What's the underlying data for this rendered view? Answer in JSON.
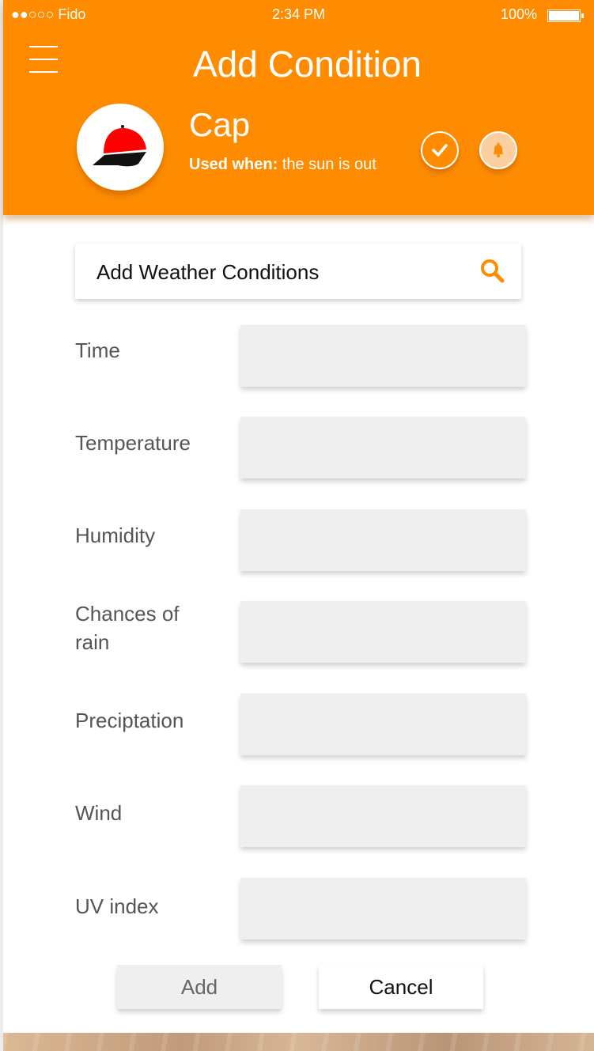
{
  "status_bar": {
    "carrier": "●●○○○ Fido",
    "time": "2:34 PM",
    "battery": "100%"
  },
  "header": {
    "title": "Add Condition",
    "item_name": "Cap",
    "used_when_label": "Used when:",
    "used_when_value": "the sun is out"
  },
  "colors": {
    "accent": "#ff8c00",
    "field_bg": "#efefef"
  },
  "icons": {
    "menu": "hamburger-icon",
    "confirm": "checkmark-icon",
    "notify": "bell-icon",
    "search": "search-icon",
    "avatar": "cap-icon"
  },
  "search": {
    "placeholder": "Add Weather Conditions"
  },
  "fields": [
    {
      "label": "Time",
      "value": ""
    },
    {
      "label": "Temperature",
      "value": ""
    },
    {
      "label": "Humidity",
      "value": ""
    },
    {
      "label": "Chances of rain",
      "value": ""
    },
    {
      "label": "Preciptation",
      "value": ""
    },
    {
      "label": "Wind",
      "value": ""
    },
    {
      "label": "UV index",
      "value": ""
    }
  ],
  "actions": {
    "add": "Add",
    "cancel": "Cancel"
  }
}
